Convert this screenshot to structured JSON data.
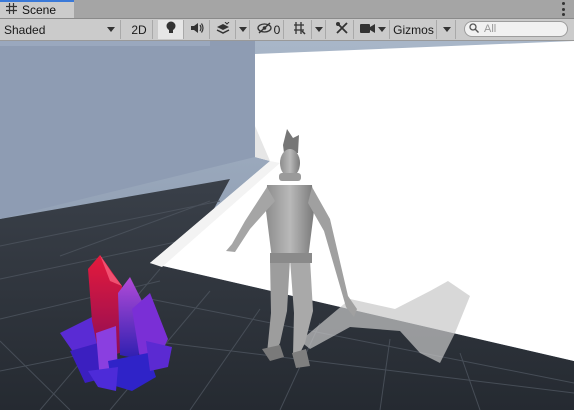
{
  "tab": {
    "title": "Scene",
    "icon": "grid-icon"
  },
  "toolbar": {
    "shading_mode": "Shaded",
    "mode_2d_label": "2D",
    "hidden_count": "0",
    "gizmos_label": "Gizmos",
    "search_placeholder": "All"
  },
  "scene": {
    "objects": [
      "crystal-cluster",
      "humanoid-character",
      "floor-grid",
      "white-walls"
    ]
  },
  "colors": {
    "accent": "#3a79d8",
    "toolbar_bg": "#cbcbcb",
    "floor": "#2b323b",
    "sky": "#8c9bb0",
    "crystal_red": "#d7142f",
    "crystal_purple": "#6a1fd0"
  }
}
